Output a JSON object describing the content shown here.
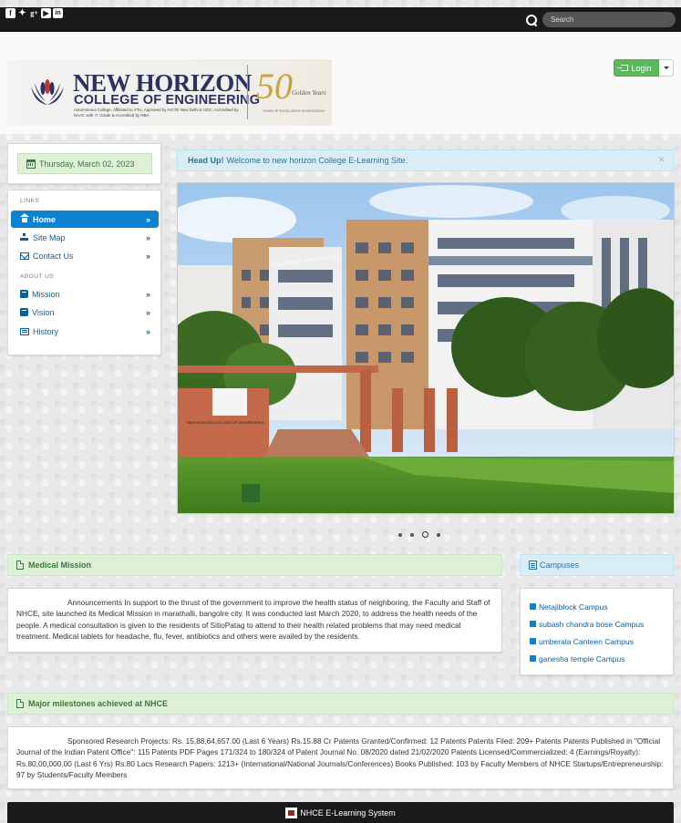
{
  "topbar": {
    "social_icons": [
      "facebook-icon",
      "twitter-icon",
      "google-plus-icon",
      "youtube-icon",
      "linkedin-icon"
    ],
    "search_placeholder": "Search"
  },
  "logo": {
    "title": "NEW HORIZON",
    "subtitle": "COLLEGE OF ENGINEERING",
    "tagline": "Autonomous College, Affiliated to VTU, Approved by AICTE New Delhi & UGC, Accredited by NAAC with 'A' Grade & Accredited by NBA",
    "anniversary_number": "50",
    "anniversary_text": "Golden Years",
    "anniversary_sub": "YEARS OF EXCELLENCE IN EDUCATION"
  },
  "login": {
    "label": "Login"
  },
  "date": "Thursday, March 02, 2023",
  "nav": {
    "links_header": "LINKS",
    "about_header": "ABOUT US",
    "links": [
      {
        "label": "Home",
        "icon": "home-icon"
      },
      {
        "label": "Site Map",
        "icon": "sitemap-icon"
      },
      {
        "label": "Contact Us",
        "icon": "envelope-icon"
      }
    ],
    "about": [
      {
        "label": "Mission",
        "icon": "book-icon"
      },
      {
        "label": "Vision",
        "icon": "book-icon"
      },
      {
        "label": "History",
        "icon": "list-icon"
      }
    ],
    "chevron": "»"
  },
  "alert": {
    "strong": "Head Up!",
    "text": "Welcome to new horizon College E-Learning Site.",
    "close": "×"
  },
  "carousel": {
    "building_sign": "CHHATRAPATI SHIVAJI BLOCK",
    "wall_sign": "NEW HORIZON COLLEGE OF ENGINEERING",
    "slide_count": 4,
    "active_slide": 3
  },
  "medical": {
    "title": "Medical Mission",
    "body": "Announcements In support to the thrust of the government to improve the health status of neighboring, the Faculty and Staff of NHCE, site launched its Medical Mission in marathalli, bangolre city. It was conducted last March 2020, to address the health needs of the people. A medical consultation is given to the residents of SitioPatag to attend to their health related problems that may need medical treatment. Medical tablets for headache, flu, fever, antibiotics and others were availed by the residents."
  },
  "campuses": {
    "title": "Campuses",
    "items": [
      "Netajiblock Campus",
      "subash chandra bose Campus",
      "umberala Canteen Campus",
      "ganesha temple Campus"
    ]
  },
  "milestones": {
    "title": "Major milestones achieved at NHCE",
    "body": "Sponsored Research Projects: Rs. 15,88,64,657.00 (Last 6 Years) Rs.15.88 Cr Patents Granted/Confirmed: 12 Patents Patents Filed: 209+ Patents Patents Published in \"Official Journal of the Indian Patent Office\": 115 Patents PDF Pages 171/324 to 180/324 of Patent Journal No. 08/2020 dated 21/02/2020 Patents Licensed/Commercialized: 4 (Earnings/Royalty): Rs.80,00,000.00 (Last 6 Yrs) Rs.80 Lacs Research Papers: 1213+ (International/National Journals/Conferences) Books Published: 103 by Faculty Members of NHCE Startups/Entrepreneurship: 97 by Students/Faculty Members"
  },
  "footer": {
    "text": "NHCE E-Learning System"
  }
}
